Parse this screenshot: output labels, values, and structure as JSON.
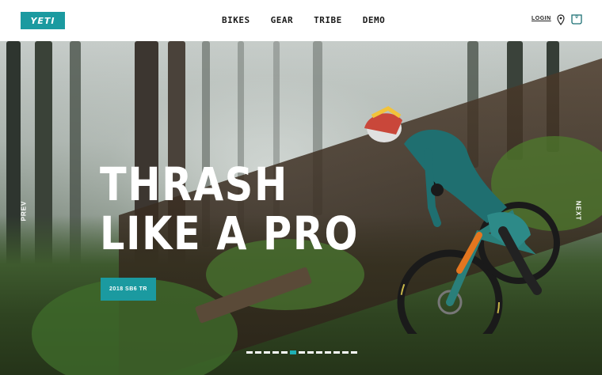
{
  "header": {
    "logo": "YETI",
    "nav": [
      "BIKES",
      "GEAR",
      "TRIBE",
      "DEMO"
    ],
    "login": "LOGIN",
    "cart_count": "0"
  },
  "hero": {
    "title_line1": "THRASH",
    "title_line2": "LIKE A PRO",
    "cta": "2018 SB6 TR",
    "prev": "PREV",
    "next": "NEXT",
    "slide_count": 13,
    "active_slide": 5
  },
  "colors": {
    "brand": "#1b9aa0",
    "active_dot": "#1fb0b5"
  }
}
